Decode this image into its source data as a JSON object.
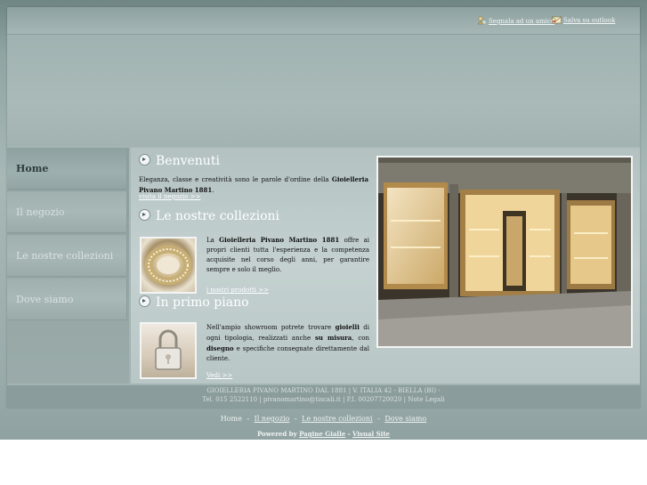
{
  "topbar": {
    "recommend_label": "Segnala ad un amico",
    "outlook_label": "Salva su outlook"
  },
  "nav": {
    "items": [
      {
        "label": "Home",
        "active": true
      },
      {
        "label": "Il negozio",
        "active": false
      },
      {
        "label": "Le nostre collezioni",
        "active": false
      },
      {
        "label": "Dove siamo",
        "active": false
      }
    ]
  },
  "main": {
    "welcome": {
      "title": "Benvenuti",
      "text_1": "Eleganza, classe e creatività sono le parole d'ordine della",
      "brand": "Gioielleria Pivano Martino 1881",
      "text_2": ".",
      "link": "visita il negozio >>"
    },
    "collections": {
      "title": "Le nostre collezioni",
      "text_1": "La",
      "brand": "Gioielleria Pivano Martino 1881",
      "text_2": "offre ai propri clienti tutta l'esperienza e la competenza acquisite nel corso degli anni, per garantire sempre e solo il meglio.",
      "link": "i nostri prodotti >>"
    },
    "featured": {
      "title": "In primo piano",
      "text_1": "Nell'ampio showroom potrete trovare",
      "bold_1": "gioielli",
      "text_2": "di ogni tipologia, realizzati anche",
      "bold_2": "su misura",
      "text_3": ", con",
      "bold_3": "disegno",
      "text_4": "e specifiche consegnate direttamente dal cliente.",
      "link": "Vedi >>"
    }
  },
  "footer": {
    "line1": "GIOIELLERIA PIVANO MARTINO DAL 1881 | V. ITALIA 42 - BIELLA (BI) -",
    "phone": "Tel. 015 2522110",
    "email": "pivanomartino@tiscali.it",
    "vat": "| P.I. 00207720020 |",
    "legal": "Note Legali"
  },
  "bottom_nav": {
    "home": "Home",
    "negozio": "Il negozio",
    "collezioni": "Le nostre collezioni",
    "dove": "Dove siamo",
    "separator": "-"
  },
  "powered": {
    "label": "Powered by",
    "pagine": "Pagine Gialle",
    "dash": "-",
    "visual": "Visual Site"
  },
  "colors": {
    "accent_text": "#ffffff",
    "footer_bg": "#8a9c9b",
    "nav_active_text": "#2e3d3c"
  },
  "icons": [
    "recommend-icon",
    "envelope-icon",
    "bullet-arrow-icon"
  ]
}
